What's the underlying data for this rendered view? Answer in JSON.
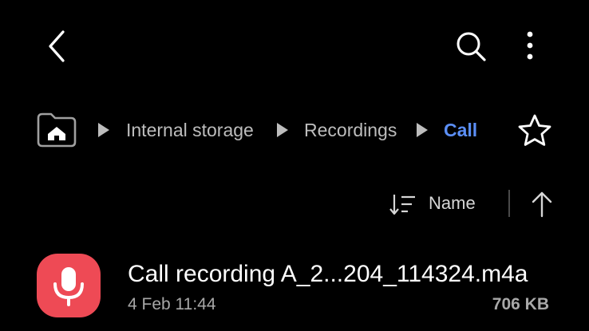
{
  "topbar": {
    "back_icon": "chevron-left-icon",
    "search_icon": "search-icon",
    "more_icon": "more-vertical-icon"
  },
  "breadcrumb": {
    "home_icon": "home-folder-icon",
    "items": [
      {
        "label": "Internal storage"
      },
      {
        "label": "Recordings"
      },
      {
        "label": "Call",
        "current": true
      }
    ],
    "favorite_icon": "star-outline-icon",
    "current_color": "#5b8ff7"
  },
  "sort": {
    "label": "Name",
    "sort_icon": "sort-lines-icon",
    "direction_icon": "arrow-up-icon"
  },
  "files": [
    {
      "name": "Call recording A_2...204_114324.m4a",
      "date": "4 Feb 11:44",
      "size": "706 KB",
      "icon": "microphone-icon",
      "icon_color": "#ee4a55"
    }
  ]
}
